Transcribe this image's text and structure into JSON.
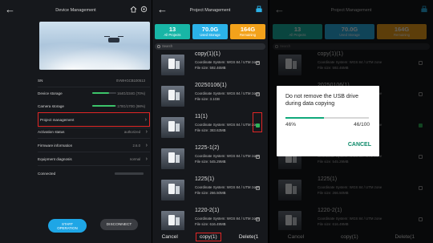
{
  "device_panel": {
    "title": "Device Management",
    "sn_label": "SN",
    "sn_value": "0VWHGCB100513",
    "device_storage_label": "Device storage",
    "device_storage_value": "164G/234G (70%)",
    "device_storage_fraction": 0.7,
    "camera_storage_label": "Camera storage",
    "camera_storage_value": "170G/170G (98%)",
    "camera_storage_fraction": 0.98,
    "project_management_label": "Project management",
    "activation_label": "Activation status",
    "activation_value": "authorized",
    "firmware_label": "Firmware information",
    "firmware_value": "2.6.0",
    "diagnosis_label": "Equipment diagnosis",
    "diagnosis_value": "normal",
    "connected_label": "Connected",
    "start_label": "START OPERATION",
    "disconnect_label": "DISCONNECT",
    "accent_color": "#1ea6e6",
    "highlight_color": "#e02626"
  },
  "project_panel": {
    "title": "Project Management",
    "tiles": [
      {
        "num": "13",
        "label": "All Projects",
        "color": "#18b6a6"
      },
      {
        "num": "70.0G",
        "label": "Used Storage",
        "color": "#2bb2e8"
      },
      {
        "num": "164G",
        "label": "Remaining",
        "color": "#f3a21b"
      }
    ],
    "search_placeholder": "Search",
    "coord_label": "Coordinate System:",
    "coord_value": "WGS 84 / UTM zone",
    "items": [
      {
        "name": "copy(1)(1)",
        "size": "File size: 592.46MB",
        "checked": false
      },
      {
        "name": "20250106(1)",
        "size": "File size: 3.1GB",
        "checked": false
      },
      {
        "name": "11(1)",
        "size": "File size: 383.63MB",
        "checked": true
      },
      {
        "name": "1225-1(2)",
        "size": "File size: 545.29MB",
        "checked": false
      },
      {
        "name": "1225(1)",
        "size": "File size: 266.50MB",
        "checked": false
      },
      {
        "name": "1220-2(1)",
        "size": "File size: 616.49MB",
        "checked": false
      }
    ],
    "cancel_label": "Cancel",
    "copy_label": "copy(1)",
    "delete_label": "Delete(1"
  },
  "dialog": {
    "message": "Do not remove the USB drive during data copying",
    "progress_percent": "46%",
    "progress_fraction": 0.46,
    "count": "46/100",
    "cancel_label": "CANCEL"
  }
}
